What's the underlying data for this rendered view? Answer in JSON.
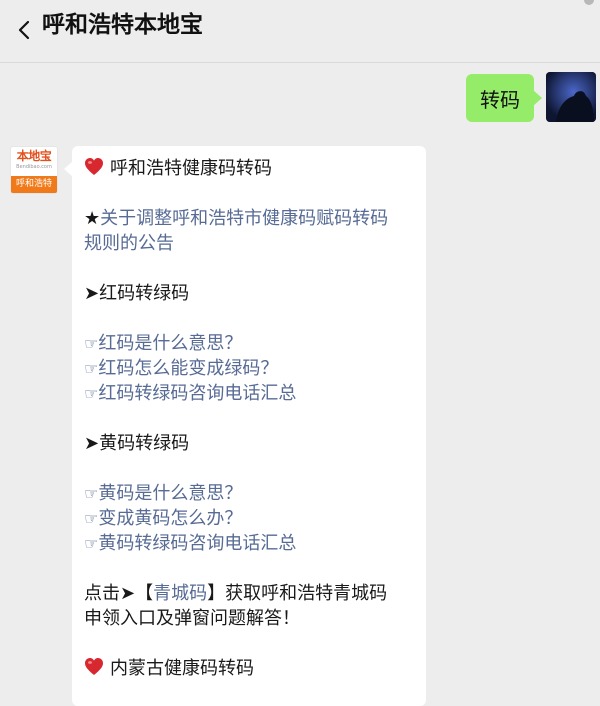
{
  "header": {
    "title": "呼和浩特本地宝"
  },
  "outgoing": {
    "text": "转码"
  },
  "bot": {
    "logo_text": "本地宝",
    "logo_domain": "Bendibao.com",
    "logo_city": "呼和浩特"
  },
  "message": {
    "section1_title": "呼和浩特健康码转码",
    "notice_star": "★",
    "notice_link_line1": "关于调整呼和浩特市健康码赋码转码",
    "notice_link_line2": "规则的公告",
    "arrow": "➤",
    "red_heading": "红码转绿码",
    "hand": "☞",
    "red_links": [
      "红码是什么意思？",
      "红码怎么能变成绿码？",
      "红码转绿码咨询电话汇总"
    ],
    "yellow_heading": "黄码转绿码",
    "yellow_links": [
      "黄码是什么意思？",
      "变成黄码怎么办？",
      "黄码转绿码咨询电话汇总"
    ],
    "click_prefix": "点击➤【",
    "click_link": "青城码",
    "click_suffix": "】获取呼和浩特青城码",
    "click_line2": "申领入口及弹窗问题解答！",
    "section2_title": "内蒙古健康码转码"
  }
}
